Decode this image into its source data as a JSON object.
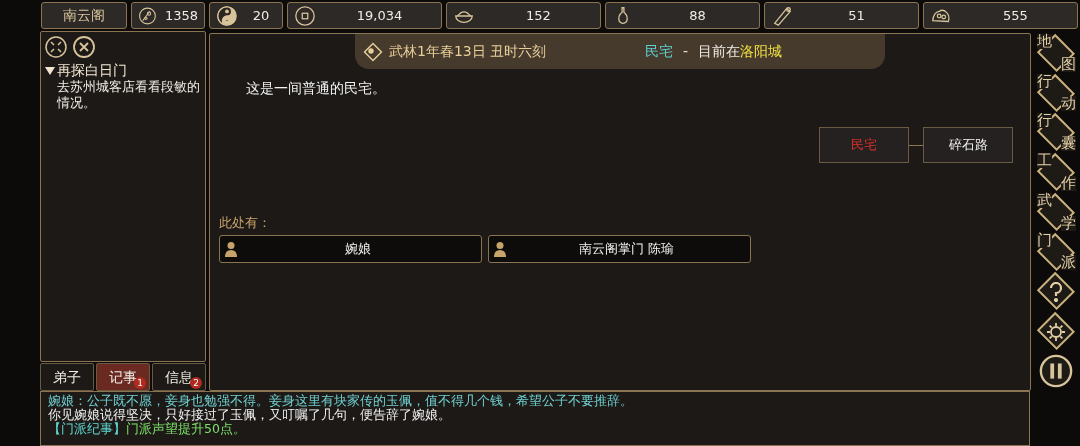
{
  "sect": {
    "name": "南云阁"
  },
  "stats": [
    {
      "value": "1358"
    },
    {
      "value": "20"
    },
    {
      "value": "19,034"
    },
    {
      "value": "152"
    },
    {
      "value": "88"
    },
    {
      "value": "51"
    },
    {
      "value": "555"
    }
  ],
  "quests": [
    {
      "title": "再探白日门",
      "expanded": true,
      "detail": "去苏州城客店看看段敏的情况。"
    }
  ],
  "tabs": [
    {
      "label": "弟子",
      "selected": false
    },
    {
      "label": "记事",
      "selected": true,
      "badge": "1"
    },
    {
      "label": "信息",
      "selected": false,
      "badge": "2"
    }
  ],
  "header": {
    "date": "武林1年春13日 丑时六刻",
    "place": "民宅",
    "separator": "-",
    "prefix": "目前在",
    "city": "洛阳城"
  },
  "description": "这是一间普通的民宅。",
  "map_nodes": [
    {
      "label": "民宅",
      "selected": true
    },
    {
      "label": "碎石路",
      "selected": false
    }
  ],
  "here": {
    "label": "此处有：",
    "people": [
      "婉娘",
      "南云阁掌门 陈瑜"
    ]
  },
  "menu": [
    {
      "kind": "text",
      "chars": [
        "地",
        "图"
      ]
    },
    {
      "kind": "text",
      "chars": [
        "行",
        "动"
      ]
    },
    {
      "kind": "text",
      "chars": [
        "行",
        "囊"
      ]
    },
    {
      "kind": "text",
      "chars": [
        "工",
        "作"
      ]
    },
    {
      "kind": "text",
      "chars": [
        "武",
        "学"
      ]
    },
    {
      "kind": "text",
      "chars": [
        "门",
        "派"
      ]
    },
    {
      "kind": "help"
    },
    {
      "kind": "settings"
    },
    {
      "kind": "pause"
    }
  ],
  "log": [
    [
      {
        "text": "婉娘：公子既不愿，妾身也勉强不得。妾身这里有块家传的玉佩，值不得几个钱，希望公子不要推辞。",
        "color": "#6fd0d0"
      }
    ],
    [
      {
        "text": "你见婉娘说得坚决，只好接过了玉佩，又叮嘱了几句，便告辞了婉娘。",
        "color": "#f2f2f2"
      }
    ],
    [
      {
        "text": "【门派纪事】",
        "color": "#5fd8d0"
      },
      {
        "text": "门派声望提升50点。",
        "color": "#7ee06a"
      }
    ]
  ]
}
